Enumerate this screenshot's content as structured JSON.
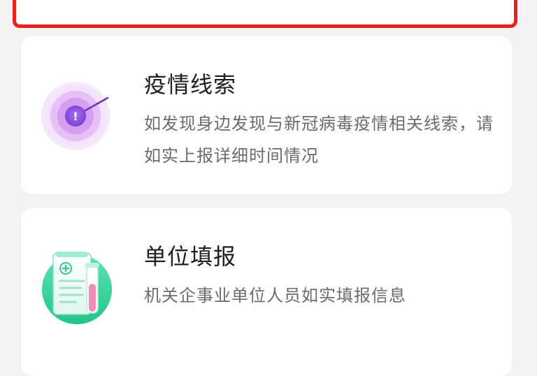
{
  "cards": [
    {
      "title": "疫情线索",
      "description": "如发现身边发现与新冠病毒疫情相关线索，请如实上报详细时间情况",
      "icon": "radar-alert-icon",
      "icon_badge": "!",
      "accent_color": "#9b59d6"
    },
    {
      "title": "单位填报",
      "description": "机关企事业单位人员如实填报信息",
      "icon": "medical-report-icon",
      "accent_color": "#2fd39a"
    }
  ],
  "colors": {
    "background": "#f3f3f5",
    "highlight_border": "#e8211d",
    "title": "#1f1f1f",
    "description": "#6b6b6b"
  }
}
